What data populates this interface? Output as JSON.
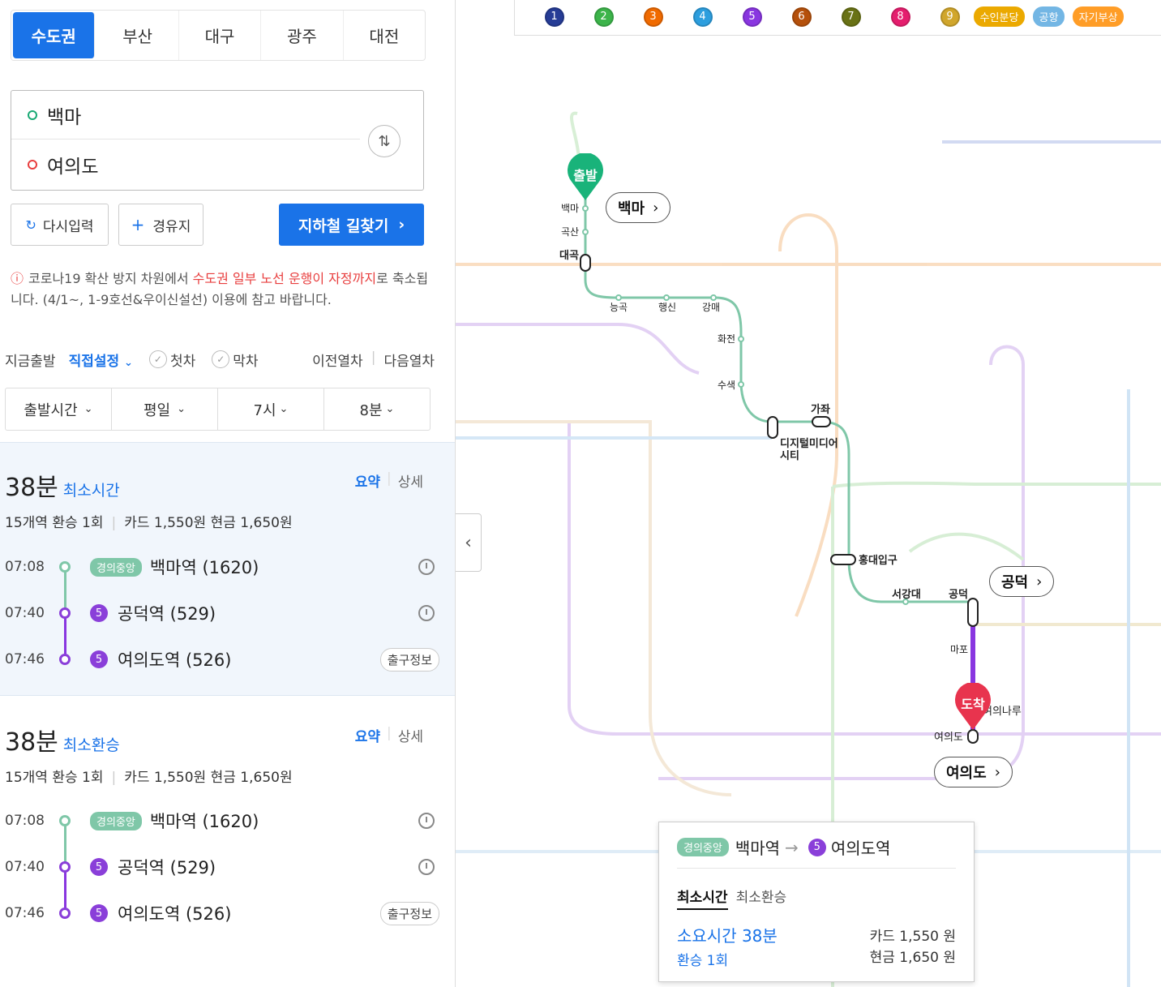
{
  "regions": [
    "수도권",
    "부산",
    "대구",
    "광주",
    "대전"
  ],
  "search": {
    "departure": "백마",
    "arrival": "여의도",
    "swap_icon": "swap-vertical-icon"
  },
  "actions": {
    "reset": "다시입력",
    "via": "경유지",
    "find": "지하철 길찾기"
  },
  "notice": {
    "pre": "코로나19 확산 방지 차원에서 ",
    "highlight": "수도권 일부 노선 운행이 자정까지",
    "post": "로 축소됩니다. (4/1~, 1-9호선&우이신설선) 이용에 참고 바랍니다."
  },
  "time_options": {
    "now": "지금출발",
    "set": "직접설정",
    "first": "첫차",
    "last": "막차",
    "prev": "이전열차",
    "next": "다음열차"
  },
  "selects": {
    "type": "출발시간",
    "day": "평일",
    "hour": "7시",
    "minute": "8분"
  },
  "routes": [
    {
      "duration": "38분",
      "kind": "최소시간",
      "summary": "요약",
      "detail": "상세",
      "stations": "15개역",
      "transfers": "환승 1회",
      "card": "카드 1,550원",
      "cash": "현금 1,650원",
      "stops": [
        {
          "time": "07:08",
          "line": "경의중앙",
          "name": "백마역 (1620)"
        },
        {
          "time": "07:40",
          "line": "5",
          "name": "공덕역 (529)"
        },
        {
          "time": "07:46",
          "line": "5",
          "name": "여의도역 (526)",
          "exit": "출구정보"
        }
      ]
    },
    {
      "duration": "38분",
      "kind": "최소환승",
      "summary": "요약",
      "detail": "상세",
      "stations": "15개역",
      "transfers": "환승 1회",
      "card": "카드 1,550원",
      "cash": "현금 1,650원",
      "stops": [
        {
          "time": "07:08",
          "line": "경의중앙",
          "name": "백마역 (1620)"
        },
        {
          "time": "07:40",
          "line": "5",
          "name": "공덕역 (529)"
        },
        {
          "time": "07:46",
          "line": "5",
          "name": "여의도역 (526)",
          "exit": "출구정보"
        }
      ]
    }
  ],
  "legend": [
    {
      "label": "1",
      "color": "#263c96"
    },
    {
      "label": "2",
      "color": "#3cb44a"
    },
    {
      "label": "3",
      "color": "#f06a00"
    },
    {
      "label": "4",
      "color": "#2c9ede"
    },
    {
      "label": "5",
      "color": "#8936e0"
    },
    {
      "label": "6",
      "color": "#b5500b"
    },
    {
      "label": "7",
      "color": "#697215"
    },
    {
      "label": "8",
      "color": "#e51e6e"
    },
    {
      "label": "9",
      "color": "#d1a62c"
    },
    {
      "label": "수인분당",
      "color": "#eba900"
    },
    {
      "label": "공항",
      "color": "#73b6e4"
    },
    {
      "label": "자기부상",
      "color": "#ff9d27"
    }
  ],
  "map": {
    "start_pin": "출발",
    "end_pin": "도착",
    "callout_start": "백마",
    "callout_transfer": "공덕",
    "callout_end": "여의도",
    "stations": [
      "백마",
      "곡산",
      "대곡",
      "능곡",
      "행신",
      "강매",
      "화전",
      "수색",
      "디지털미디어시티",
      "가좌",
      "홍대입구",
      "서강대",
      "공덕",
      "마포",
      "여의나루",
      "여의도"
    ]
  },
  "popup": {
    "from_line": "경의중앙",
    "from": "백마역",
    "to_line": "5",
    "to": "여의도역",
    "tab_min_time": "최소시간",
    "tab_min_transfer": "최소환승",
    "duration": "소요시간 38분",
    "transfers": "환승 1회",
    "card": "카드 1,550 원",
    "cash": "현금 1,650 원"
  },
  "colors": {
    "accent": "#1a73e8",
    "gyeongui": "#7fc7a8",
    "line5": "#8936e0",
    "alert": "#e83e3e"
  }
}
